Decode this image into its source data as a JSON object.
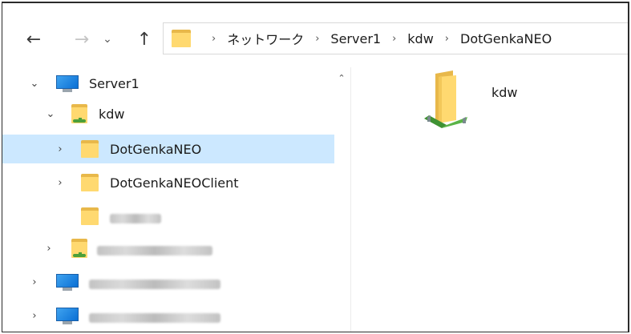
{
  "nav": {
    "back_glyph": "←",
    "forward_glyph": "→",
    "recent_glyph": "⌄",
    "up_glyph": "↑"
  },
  "address": {
    "separator": "›",
    "crumbs": [
      "ネットワーク",
      "Server1",
      "kdw",
      "DotGenkaNEO"
    ]
  },
  "tree": {
    "items": [
      {
        "label": "Server1",
        "expand": "⌄"
      },
      {
        "label": "kdw",
        "expand": "⌄"
      },
      {
        "label": "DotGenkaNEO",
        "expand": "›"
      },
      {
        "label": "DotGenkaNEOClient",
        "expand": "›"
      },
      {
        "expand": "›"
      },
      {
        "expand": "›"
      },
      {
        "expand": "›"
      }
    ],
    "scroll_up_glyph": "⌃"
  },
  "content": {
    "items": [
      {
        "label": "kdw"
      }
    ]
  },
  "colors": {
    "selection": "#cce8ff",
    "folder": "#ffd970",
    "share": "#4ca03a"
  }
}
